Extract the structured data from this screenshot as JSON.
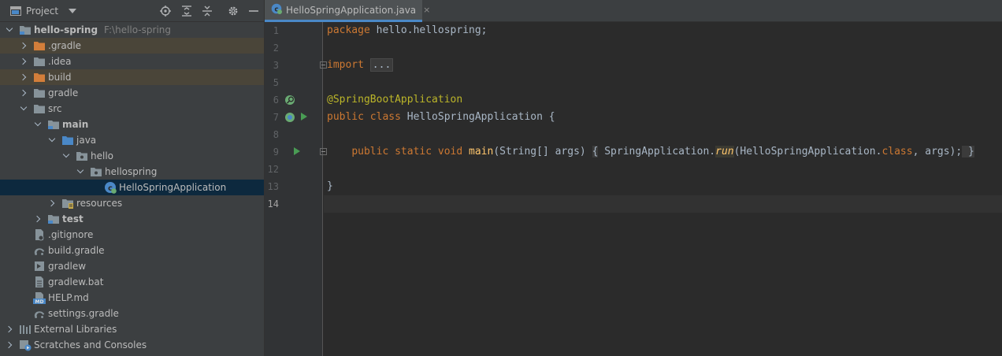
{
  "project_panel": {
    "title": "Project",
    "toolbar_icons": [
      "locate-icon",
      "expand-all-icon",
      "collapse-all-icon",
      "gear-icon",
      "minimize-icon"
    ],
    "tree": [
      {
        "label": "hello-spring",
        "path": "F:\\hello-spring",
        "icon": "module-folder-icon",
        "chevron": "down",
        "depth": 0,
        "bold": true
      },
      {
        "label": ".gradle",
        "icon": "excluded-folder-icon",
        "chevron": "right",
        "depth": 1,
        "excluded": true
      },
      {
        "label": ".idea",
        "icon": "folder-icon",
        "chevron": "right",
        "depth": 1
      },
      {
        "label": "build",
        "icon": "excluded-folder-icon",
        "chevron": "right",
        "depth": 1,
        "excluded": true
      },
      {
        "label": "gradle",
        "icon": "folder-icon",
        "chevron": "right",
        "depth": 1
      },
      {
        "label": "src",
        "icon": "folder-icon",
        "chevron": "down",
        "depth": 1
      },
      {
        "label": "main",
        "icon": "module-folder-icon",
        "chevron": "down",
        "depth": 2,
        "bold": true
      },
      {
        "label": "java",
        "icon": "source-folder-icon",
        "chevron": "down",
        "depth": 3
      },
      {
        "label": "hello",
        "icon": "package-icon",
        "chevron": "down",
        "depth": 4
      },
      {
        "label": "hellospring",
        "icon": "package-icon",
        "chevron": "down",
        "depth": 5
      },
      {
        "label": "HelloSpringApplication",
        "icon": "spring-class-icon",
        "chevron": "none",
        "depth": 6,
        "selected": true
      },
      {
        "label": "resources",
        "icon": "resources-folder-icon",
        "chevron": "right",
        "depth": 3
      },
      {
        "label": "test",
        "icon": "module-folder-icon",
        "chevron": "right",
        "depth": 2,
        "bold": true
      },
      {
        "label": ".gitignore",
        "icon": "gitignore-file-icon",
        "chevron": "none",
        "depth": 1
      },
      {
        "label": "build.gradle",
        "icon": "gradle-file-icon",
        "chevron": "none",
        "depth": 1
      },
      {
        "label": "gradlew",
        "icon": "script-file-icon",
        "chevron": "none",
        "depth": 1
      },
      {
        "label": "gradlew.bat",
        "icon": "text-file-icon",
        "chevron": "none",
        "depth": 1
      },
      {
        "label": "HELP.md",
        "icon": "markdown-file-icon",
        "chevron": "none",
        "depth": 1
      },
      {
        "label": "settings.gradle",
        "icon": "gradle-file-icon",
        "chevron": "none",
        "depth": 1
      },
      {
        "label": "External Libraries",
        "icon": "libraries-icon",
        "chevron": "right",
        "depth": 0
      },
      {
        "label": "Scratches and Consoles",
        "icon": "scratches-icon",
        "chevron": "right",
        "depth": 0
      }
    ]
  },
  "editor": {
    "tab": {
      "label": "HelloSpringApplication.java",
      "close": "×",
      "icon": "spring-class-icon"
    },
    "line_numbers": [
      "1",
      "2",
      "3",
      "5",
      "6",
      "7",
      "8",
      "9",
      "12",
      "13",
      "14"
    ],
    "current_line": "14",
    "code": {
      "l1_kw": "package",
      "l1_rest": " hello.hellospring;",
      "l3_kw": "import",
      "l3_fold": "...",
      "l6_ann": "@SpringBootApplication",
      "l7_kw": "public class",
      "l7_rest": " HelloSpringApplication {",
      "l9_indent": "    ",
      "l9_kw": "public static void",
      "l9_fn": "main",
      "l9_args": "(String[] args) ",
      "l9_open": "{",
      "l9_call": " SpringApplication.",
      "l9_run": "run",
      "l9_call2": "(HelloSpringApplication.",
      "l9_class_kw": "class",
      "l9_rest": ", args);",
      "l9_close": " }",
      "l13": "}"
    }
  },
  "colors": {
    "accent": "#4a88c7",
    "keyword": "#cc7832",
    "annotation": "#bbb529",
    "method": "#ffc66d",
    "spring_green": "#6aab73",
    "run_green": "#499c54"
  }
}
